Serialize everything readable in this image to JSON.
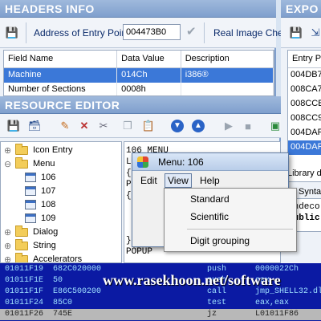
{
  "headers": {
    "title": "HEADERS INFO",
    "address_label": "Address of Entry Point:",
    "address_value": "004473B0",
    "real_image_label": "Real Image Che",
    "columns": [
      "Field Name",
      "Data Value",
      "Description"
    ],
    "rows": [
      {
        "field": "Machine",
        "value": "014Ch",
        "desc": "i386®"
      },
      {
        "field": "Number of Sections",
        "value": "0008h",
        "desc": ""
      }
    ]
  },
  "exports": {
    "title": "EXPO",
    "column": "Entry Po",
    "items": [
      "004DB7",
      "008CA7",
      "008CCB",
      "008CC9",
      "004DAF",
      "004DAF"
    ],
    "selected_index": 5,
    "library_label": "Library d",
    "syntax_label": "Synta",
    "code_lines": [
      "Undeco",
      "public"
    ]
  },
  "resource_editor": {
    "title": "RESOURCE EDITOR",
    "tree": [
      {
        "label": "Icon Entry",
        "type": "folder",
        "level": 0
      },
      {
        "label": "Menu",
        "type": "folder",
        "level": 0
      },
      {
        "label": "106",
        "type": "dialog",
        "level": 1
      },
      {
        "label": "107",
        "type": "dialog",
        "level": 1
      },
      {
        "label": "108",
        "type": "dialog",
        "level": 1
      },
      {
        "label": "109",
        "type": "dialog",
        "level": 1
      },
      {
        "label": "Dialog",
        "type": "folder",
        "level": 0
      },
      {
        "label": "String",
        "type": "folder",
        "level": 0
      },
      {
        "label": "Accelerators",
        "type": "folder",
        "level": 0
      }
    ],
    "code_lines": [
      "106 MENU",
      "L",
      "{",
      "P",
      "{",
      "",
      "",
      "",
      "}",
      "POPUP"
    ]
  },
  "menu_window": {
    "title": "Menu: 106",
    "menu_items": [
      "Edit",
      "View",
      "Help"
    ],
    "active_menu": "View",
    "dropdown": [
      "Standard",
      "Scientific",
      "Digit grouping"
    ]
  },
  "disassembly": [
    {
      "addr": "01011F19",
      "bytes": "682C020000",
      "op": "push",
      "arg": "0000022Ch"
    },
    {
      "addr": "01011F1E",
      "bytes": "50",
      "op": "push",
      "arg": "eax"
    },
    {
      "addr": "01011F1F",
      "bytes": "E86C500200",
      "op": "call",
      "arg": "jmp_SHELL32.dll!S"
    },
    {
      "addr": "01011F24",
      "bytes": "85C0",
      "op": "test",
      "arg": "eax,eax"
    },
    {
      "addr": "01011F26",
      "bytes": "745E",
      "op": "jz",
      "arg": "L01011F86"
    }
  ],
  "watermark": "www.rasekhoon.net/software",
  "colors": {
    "selection": "#3b78d8",
    "title_bar": "#8fabd6",
    "disasm_bg": "#0b1aa3"
  }
}
